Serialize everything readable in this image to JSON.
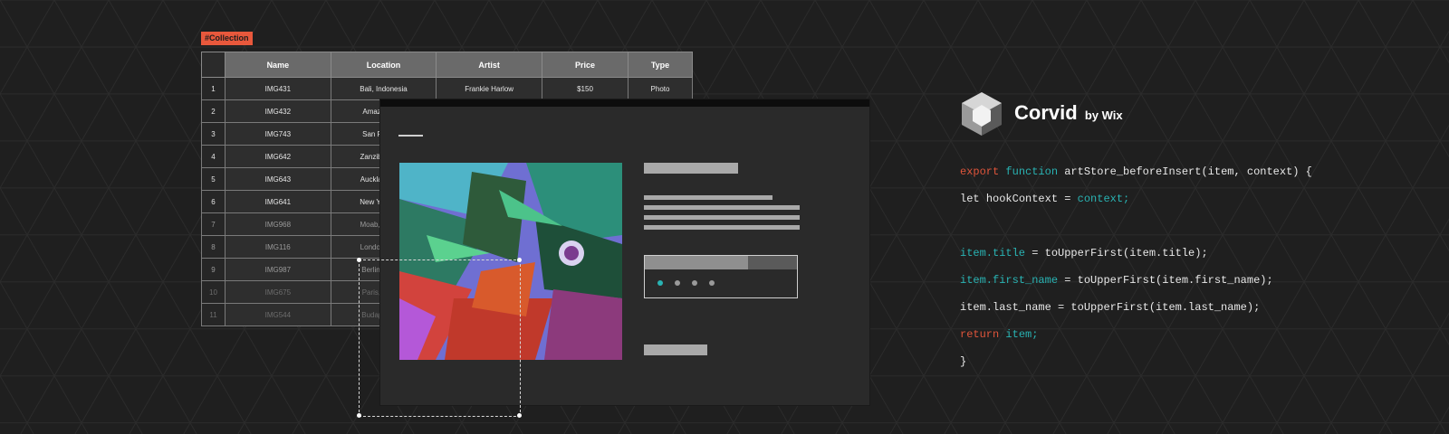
{
  "tag": "#Collection",
  "table": {
    "columns": [
      "Name",
      "Location",
      "Artist",
      "Price",
      "Type"
    ],
    "rows": [
      [
        "1",
        "IMG431",
        "Bali, Indonesia",
        "Frankie Harlow",
        "$150",
        "Photo"
      ],
      [
        "2",
        "IMG432",
        "Amazon, Bra",
        "",
        "",
        ""
      ],
      [
        "3",
        "IMG743",
        "San Francisc",
        "",
        "",
        ""
      ],
      [
        "4",
        "IMG642",
        "Zanzibar, Tanz",
        "",
        "",
        ""
      ],
      [
        "5",
        "IMG643",
        "Auckland, Nev",
        "",
        "",
        ""
      ],
      [
        "6",
        "IMG641",
        "New York, Nev",
        "",
        "",
        ""
      ],
      [
        "7",
        "IMG968",
        "Moab, Nevade",
        "",
        "",
        ""
      ],
      [
        "8",
        "IMG116",
        "London, Engla",
        "",
        "",
        ""
      ],
      [
        "9",
        "IMG987",
        "Berlin, Berma",
        "",
        "",
        ""
      ],
      [
        "10",
        "IMG675",
        "Paris, France",
        "",
        "",
        ""
      ],
      [
        "11",
        "IMG544",
        "Budapest, Hu",
        "",
        "",
        ""
      ]
    ]
  },
  "brand": {
    "title": "Corvid",
    "subtitle": "by Wix"
  },
  "code": {
    "line1": {
      "kw1": "export ",
      "kw2": "function ",
      "rest": "artStore_beforeInsert(item, context) {"
    },
    "line2": {
      "kw": "let ",
      "mid": "hookContext = ",
      "val": "context;"
    },
    "line3": {
      "obj": "item.title",
      "rest": " = toUpperFirst(item.title);"
    },
    "line4": {
      "obj": "item.first_name",
      "rest": " = toUpperFirst(item.first_name);"
    },
    "line5": {
      "obj": "item.last_name",
      "rest": " = toUpperFirst(item.last_name);"
    },
    "line6": {
      "kw": "return ",
      "val": "item;"
    },
    "line7": "}"
  },
  "colors": {
    "accent_orange": "#e8583c",
    "accent_teal": "#29b3b3",
    "background": "#1f1f1f"
  },
  "slider": {
    "active_dot": 1,
    "dot_count": 4
  }
}
